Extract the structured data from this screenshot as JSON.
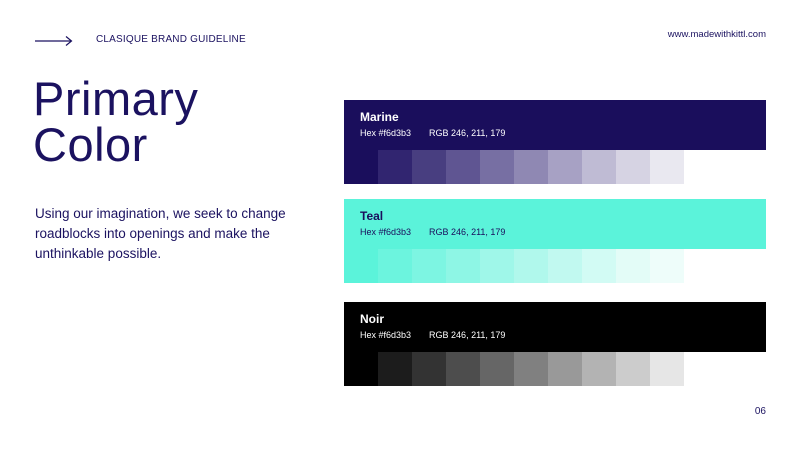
{
  "header": {
    "brand": "CLASIQUE BRAND GUIDELINE",
    "website": "www.madewithkittl.com"
  },
  "title": "Primary\nColor",
  "description": "Using our imagination, we seek to change roadblocks into openings and make the unthinkable possible.",
  "page_number": "06",
  "palettes": [
    {
      "name": "Marine",
      "hex": "Hex #f6d3b3",
      "rgb": "RGB 246, 211, 179",
      "banner_color": "#1a0e5c",
      "text_color": "#ffffff",
      "shades": [
        "#1a0e5c",
        "#312570",
        "#483e80",
        "#5f5592",
        "#776fa3",
        "#8f88b3",
        "#a7a1c4",
        "#bfbbd4",
        "#d6d3e3",
        "#e9e8f0"
      ]
    },
    {
      "name": "Teal",
      "hex": "Hex #f6d3b3",
      "rgb": "RGB 246, 211, 179",
      "banner_color": "#5bf3da",
      "text_color": "#1a0e5c",
      "shades": [
        "#5bf3da",
        "#6cf4de",
        "#7df5e2",
        "#8ef6e5",
        "#9ff7e9",
        "#b0f8ec",
        "#c1f9f0",
        "#d2fbf4",
        "#e3fcf7",
        "#eefdfa"
      ]
    },
    {
      "name": "Noir",
      "hex": "Hex #f6d3b3",
      "rgb": "RGB 246, 211, 179",
      "banner_color": "#000000",
      "text_color": "#ffffff",
      "shades": [
        "#000000",
        "#1c1c1c",
        "#333333",
        "#4d4d4d",
        "#666666",
        "#808080",
        "#999999",
        "#b3b3b3",
        "#cccccc",
        "#e6e6e6"
      ]
    }
  ]
}
